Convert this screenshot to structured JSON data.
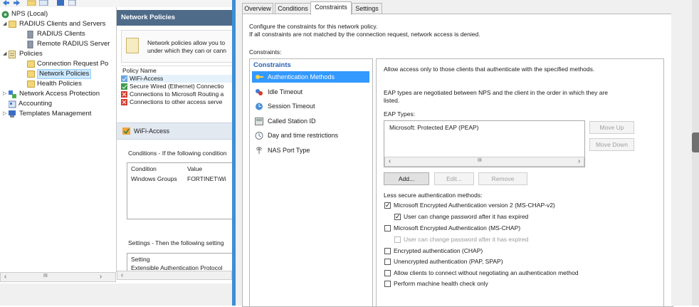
{
  "tree": {
    "items": [
      {
        "label": "NPS (Local)"
      },
      {
        "label": "RADIUS Clients and Servers"
      },
      {
        "label": "RADIUS Clients"
      },
      {
        "label": "Remote RADIUS Server"
      },
      {
        "label": "Policies"
      },
      {
        "label": "Connection Request Po"
      },
      {
        "label": "Network Policies"
      },
      {
        "label": "Health Policies"
      },
      {
        "label": "Network Access Protection"
      },
      {
        "label": "Accounting"
      },
      {
        "label": "Templates Management"
      }
    ],
    "scroll_thumb": "III"
  },
  "middle": {
    "header": "Network Policies",
    "desc_line1": "Network policies allow you to",
    "desc_line2": "under which they can or cann",
    "list_header": "Policy Name",
    "policies": [
      {
        "name": "WiFi-Access"
      },
      {
        "name": "Secure Wired (Ethernet) Connectio"
      },
      {
        "name": "Connections to Microsoft Routing a"
      },
      {
        "name": "Connections to other access serve"
      }
    ],
    "selected_policy": "WiFi-Access",
    "conditions_label": "Conditions - If the following condition",
    "cond_col1": "Condition",
    "cond_col2": "Value",
    "cond_row_c": "Windows Groups",
    "cond_row_v": "FORTINET\\Wi",
    "settings_label": "Settings - Then the following setting",
    "settings_col": "Setting",
    "settings_row": "Extensible Authentication Protocol"
  },
  "dialog": {
    "tabs": [
      {
        "label": "Overview"
      },
      {
        "label": "Conditions"
      },
      {
        "label": "Constraints"
      },
      {
        "label": "Settings"
      }
    ],
    "active_tab": "Constraints",
    "intro1": "Configure the constraints for this network policy.",
    "intro2": "If all constraints are not matched by the connection request, network access is denied.",
    "constraints_label": "Constraints:",
    "list_title": "Constraints",
    "constraints": [
      {
        "label": "Authentication Methods"
      },
      {
        "label": "Idle Timeout"
      },
      {
        "label": "Session Timeout"
      },
      {
        "label": "Called Station ID"
      },
      {
        "label": "Day and time restrictions"
      },
      {
        "label": "NAS Port Type"
      }
    ],
    "right": {
      "allow_text": "Allow access only to those clients that authenticate with the specified methods.",
      "eap_text1": "EAP types are negotiated between NPS and the client in the order in which they are",
      "eap_text2": "listed.",
      "eap_types_label": "EAP Types:",
      "eap_item": "Microsoft: Protected EAP (PEAP)",
      "scroll_thumb": "III",
      "move_up": "Move Up",
      "move_down": "Move Down",
      "add": "Add...",
      "edit": "Edit...",
      "remove": "Remove",
      "less_secure": "Less secure authentication methods:",
      "options": [
        {
          "label": "Microsoft Encrypted Authentication version 2 (MS-CHAP-v2)",
          "checked": true,
          "enabled": true
        },
        {
          "label": "User can change password after it has expired",
          "checked": true,
          "enabled": true
        },
        {
          "label": "Microsoft Encrypted Authentication (MS-CHAP)",
          "checked": false,
          "enabled": true
        },
        {
          "label": "User can change password after it has expired",
          "checked": false,
          "enabled": false
        },
        {
          "label": "Encrypted authentication (CHAP)",
          "checked": false,
          "enabled": true
        },
        {
          "label": "Unencrypted authentication (PAP, SPAP)",
          "checked": false,
          "enabled": true
        },
        {
          "label": "Allow clients to connect without negotiating an authentication method",
          "checked": false,
          "enabled": true
        },
        {
          "label": "Perform machine health check only",
          "checked": false,
          "enabled": true
        }
      ]
    }
  },
  "colors": {
    "accent": "#3399ff",
    "divider": "#3c8fd8",
    "header_bg": "#4f6b8a"
  }
}
